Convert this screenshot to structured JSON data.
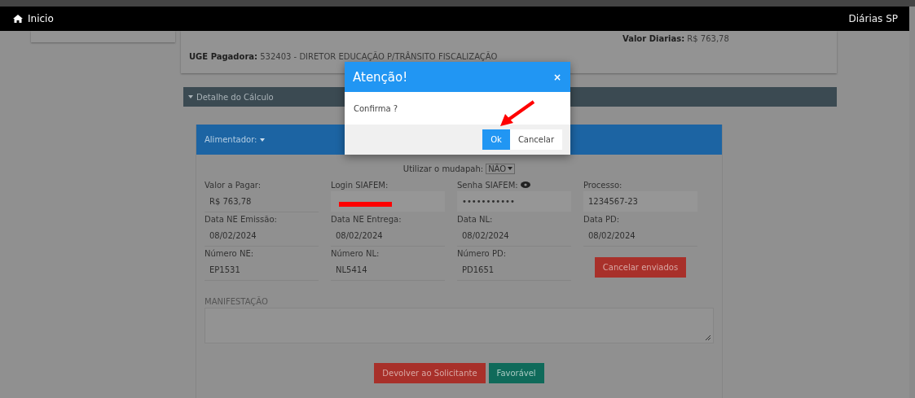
{
  "navbar": {
    "home_label": "Inicio",
    "brand": "Diárias SP"
  },
  "summary": {
    "valor_label": "Valor Diarias:",
    "valor_value": "R$ 763,78",
    "uge_label": "UGE Pagadora:",
    "uge_value": "532403 - DIRETOR EDUCAÇÃO P/TRÂNSITO FISCALIZAÇÃO"
  },
  "detail_section": {
    "label": "Detalhe do Cálculo",
    "expanded": true
  },
  "panel": {
    "title": "Alimentador:",
    "mudapah_label": "Utilizar o mudapah:",
    "mudapah_value": "NÃO",
    "fields": [
      {
        "kind": "text",
        "label": "Valor a Pagar:",
        "value": "R$ 763,78"
      },
      {
        "kind": "redacted",
        "label": "Login SIAFEM:"
      },
      {
        "kind": "password",
        "label": "Senha SIAFEM:",
        "value": "•••••••••••"
      },
      {
        "kind": "text",
        "label": "Processo:",
        "value": "1234567-23"
      },
      {
        "kind": "text",
        "label": "Data NE Emissão:",
        "value": "08/02/2024"
      },
      {
        "kind": "text",
        "label": "Data NE Entrega:",
        "value": "08/02/2024"
      },
      {
        "kind": "text",
        "label": "Data NL:",
        "value": "08/02/2024"
      },
      {
        "kind": "text",
        "label": "Data PD:",
        "value": "08/02/2024"
      },
      {
        "kind": "text",
        "label": "Número NE:",
        "value": "EP1531"
      },
      {
        "kind": "text",
        "label": "Número NL:",
        "value": "NL5414"
      },
      {
        "kind": "text",
        "label": "Número PD:",
        "value": "PD1651"
      },
      {
        "kind": "button",
        "label": "Cancelar enviados"
      }
    ],
    "manifestacao_label": "MANIFESTAÇÃO",
    "actions": [
      {
        "kind": "danger",
        "label": "Devolver ao Solicitante"
      },
      {
        "kind": "success",
        "label": "Favorável"
      }
    ]
  },
  "modal": {
    "title": "Atenção!",
    "close": "×",
    "message": "Confirma ?",
    "buttons": [
      {
        "kind": "primary",
        "label": "Ok"
      },
      {
        "kind": "default",
        "label": "Cancelar"
      }
    ]
  }
}
